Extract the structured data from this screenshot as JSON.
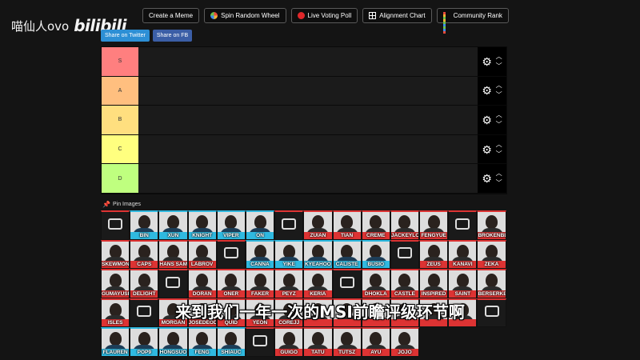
{
  "watermark": {
    "user": "喵仙人ovo",
    "brand": "bilibili"
  },
  "toolbar": [
    {
      "label": "Create a Meme",
      "icon": "none"
    },
    {
      "label": "Spin Random Wheel",
      "icon": "wheel-icon"
    },
    {
      "label": "Live Voting Poll",
      "icon": "record-icon"
    },
    {
      "label": "Alignment Chart",
      "icon": "grid-icon"
    },
    {
      "label": "Community Rank",
      "icon": "rank-icon"
    }
  ],
  "share": {
    "twitter": "Share on Twitter",
    "facebook": "Share on FB"
  },
  "tiers": [
    {
      "label": "S",
      "color": "#ff7f7f"
    },
    {
      "label": "A",
      "color": "#ffbf7f"
    },
    {
      "label": "B",
      "color": "#ffdf7f"
    },
    {
      "label": "C",
      "color": "#ffff7f"
    },
    {
      "label": "D",
      "color": "#bfff7f"
    }
  ],
  "pin_label": "Pin Images",
  "cards": [
    {
      "name": "",
      "kind": "logo",
      "accent": "#d33"
    },
    {
      "name": "BIN",
      "accent": "#2fb9e0"
    },
    {
      "name": "XUN",
      "accent": "#2fb9e0"
    },
    {
      "name": "KNIGHT",
      "accent": "#2fb9e0"
    },
    {
      "name": "VIPER",
      "accent": "#2fb9e0"
    },
    {
      "name": "ON",
      "accent": "#2fb9e0"
    },
    {
      "name": "",
      "kind": "logo",
      "accent": "#d33"
    },
    {
      "name": "ZUIAN",
      "accent": "#d33"
    },
    {
      "name": "TIAN",
      "accent": "#d33"
    },
    {
      "name": "CREME",
      "accent": "#d33"
    },
    {
      "name": "JACKEYLOVE",
      "accent": "#d33"
    },
    {
      "name": "FENGYUE",
      "accent": "#d33"
    },
    {
      "name": "",
      "kind": "logo",
      "accent": "#d33"
    },
    {
      "name": "BROKENBLADE",
      "accent": "#d33"
    },
    {
      "name": "SKEWMOND",
      "accent": "#d33"
    },
    {
      "name": "CAPS",
      "accent": "#d33"
    },
    {
      "name": "HANS SAMA",
      "accent": "#d33"
    },
    {
      "name": "LABROV",
      "accent": "#d33"
    },
    {
      "name": "",
      "kind": "logo",
      "accent": "#d33"
    },
    {
      "name": "CANNA",
      "accent": "#2fb9e0"
    },
    {
      "name": "YIKE",
      "accent": "#2fb9e0"
    },
    {
      "name": "KYEAHOO",
      "accent": "#2fb9e0"
    },
    {
      "name": "CALISTE",
      "accent": "#2fb9e0"
    },
    {
      "name": "BUSIO",
      "accent": "#2fb9e0"
    },
    {
      "name": "",
      "kind": "logo",
      "accent": "#d33"
    },
    {
      "name": "ZEUS",
      "accent": "#d33"
    },
    {
      "name": "KANAVI",
      "accent": "#d33"
    },
    {
      "name": "ZEKA",
      "accent": "#d33"
    },
    {
      "name": "GUMAYUSI",
      "accent": "#d33"
    },
    {
      "name": "DELIGHT",
      "accent": "#d33"
    },
    {
      "name": "",
      "kind": "logo",
      "accent": "#d33"
    },
    {
      "name": "DORAN",
      "accent": "#d33"
    },
    {
      "name": "ONER",
      "accent": "#d33"
    },
    {
      "name": "FAKER",
      "accent": "#d33"
    },
    {
      "name": "PEYZ",
      "accent": "#d33"
    },
    {
      "name": "KERIA",
      "accent": "#d33"
    },
    {
      "name": "",
      "kind": "logo",
      "accent": "#d33"
    },
    {
      "name": "DHOKLA",
      "accent": "#d33"
    },
    {
      "name": "CASTLE",
      "accent": "#d33"
    },
    {
      "name": "INSPIRED",
      "accent": "#d33"
    },
    {
      "name": "SAINT",
      "accent": "#d33"
    },
    {
      "name": "BERSERKER",
      "accent": "#d33"
    },
    {
      "name": "ISLES",
      "accent": "#d33"
    },
    {
      "name": "",
      "kind": "logo",
      "accent": "#d33"
    },
    {
      "name": "MORGAN",
      "accent": "#d33"
    },
    {
      "name": "JOSEDEODO",
      "accent": "#d33"
    },
    {
      "name": "QUID",
      "accent": "#d33"
    },
    {
      "name": "YEON",
      "accent": "#d33"
    },
    {
      "name": "COREJJ",
      "accent": "#d33"
    },
    {
      "name": "",
      "accent": "#d33"
    },
    {
      "name": "",
      "accent": "#d33"
    },
    {
      "name": "",
      "accent": "#d33"
    },
    {
      "name": "",
      "accent": "#d33"
    },
    {
      "name": "",
      "accent": "#d33"
    },
    {
      "name": "",
      "accent": "#d33"
    },
    {
      "name": "",
      "kind": "logo",
      "accent": "#d33"
    },
    {
      "name": "FLAUREN",
      "accent": "#2fb9e0"
    },
    {
      "name": "POP9",
      "accent": "#2fb9e0"
    },
    {
      "name": "HONGSUO",
      "accent": "#2fb9e0"
    },
    {
      "name": "FENG",
      "accent": "#2fb9e0"
    },
    {
      "name": "SHIAUC",
      "accent": "#2fb9e0"
    },
    {
      "name": "",
      "kind": "logo",
      "accent": "#d33"
    },
    {
      "name": "GUIGO",
      "accent": "#d33"
    },
    {
      "name": "TATU",
      "accent": "#d33"
    },
    {
      "name": "TUTSZ",
      "accent": "#d33"
    },
    {
      "name": "AYU",
      "accent": "#d33"
    },
    {
      "name": "JOJO",
      "accent": "#d33"
    }
  ],
  "subtitle": "来到我们一年一次的MSI前瞻评级环节啊"
}
